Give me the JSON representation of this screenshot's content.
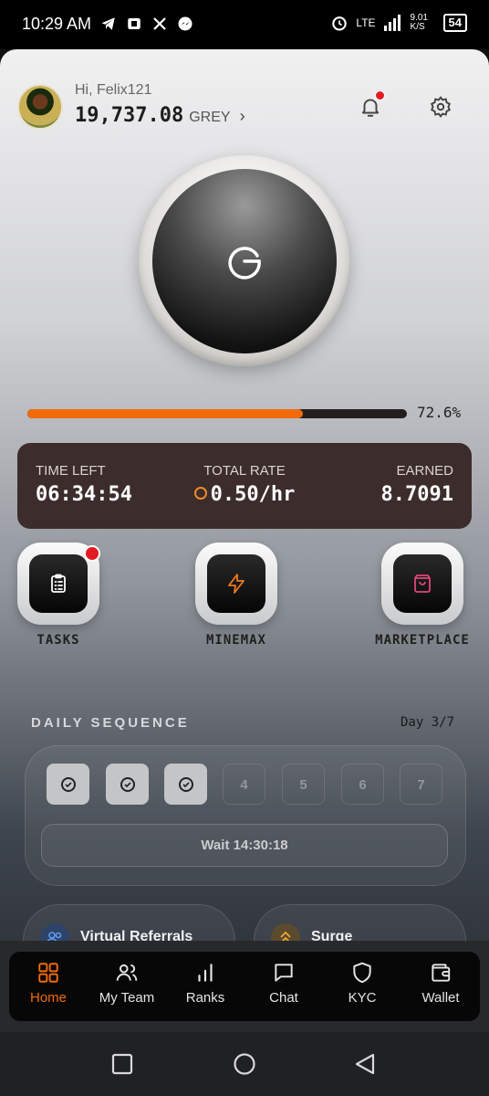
{
  "status_bar": {
    "time": "10:29 AM",
    "network": "LTE",
    "speed": "9.01 K/S",
    "battery": "54",
    "notification_icons": [
      "telegram-icon",
      "app-icon",
      "x-icon",
      "messenger-icon"
    ]
  },
  "header": {
    "greeting": "Hi, Felix121",
    "balance": "19,737.08",
    "currency": "GREY",
    "chevron": "›"
  },
  "mining": {
    "progress_percent": 72.6,
    "progress_label": "72.6%"
  },
  "stats": {
    "time_left_label": "TIME LEFT",
    "time_left": "06:34:54",
    "rate_label": "TOTAL RATE",
    "rate": "0.50/hr",
    "earned_label": "EARNED",
    "earned": "8.7091"
  },
  "actions": [
    {
      "label": "TASKS",
      "icon": "clipboard-icon",
      "color": "#ffffff"
    },
    {
      "label": "MINEMAX",
      "icon": "lightning-icon",
      "color": "#f07a1a"
    },
    {
      "label": "MARKETPLACE",
      "icon": "shopping-bag-icon",
      "color": "#e0457b"
    }
  ],
  "daily_sequence": {
    "title": "DAILY SEQUENCE",
    "day_label": "Day 3/7",
    "days": [
      {
        "label": "",
        "done": true
      },
      {
        "label": "",
        "done": true
      },
      {
        "label": "",
        "done": true
      },
      {
        "label": "4",
        "done": false
      },
      {
        "label": "5",
        "done": false
      },
      {
        "label": "6",
        "done": false
      },
      {
        "label": "7",
        "done": false
      }
    ],
    "wait_text": "Wait 14:30:18"
  },
  "cards": [
    {
      "label": "Virtual Referrals",
      "icon": "users-icon"
    },
    {
      "label": "Surge",
      "icon": "chevrons-up-icon"
    }
  ],
  "nav": {
    "items": [
      {
        "label": "Home",
        "icon": "grid-icon",
        "active": true
      },
      {
        "label": "My Team",
        "icon": "users-icon",
        "active": false
      },
      {
        "label": "Ranks",
        "icon": "bar-chart-icon",
        "active": false
      },
      {
        "label": "Chat",
        "icon": "chat-icon",
        "active": false
      },
      {
        "label": "KYC",
        "icon": "shield-icon",
        "active": false
      },
      {
        "label": "Wallet",
        "icon": "wallet-icon",
        "active": false
      }
    ]
  },
  "colors": {
    "accent": "#f26b0a",
    "stats_bg": "#3c2d2c",
    "notification_dot": "#e31b23"
  }
}
